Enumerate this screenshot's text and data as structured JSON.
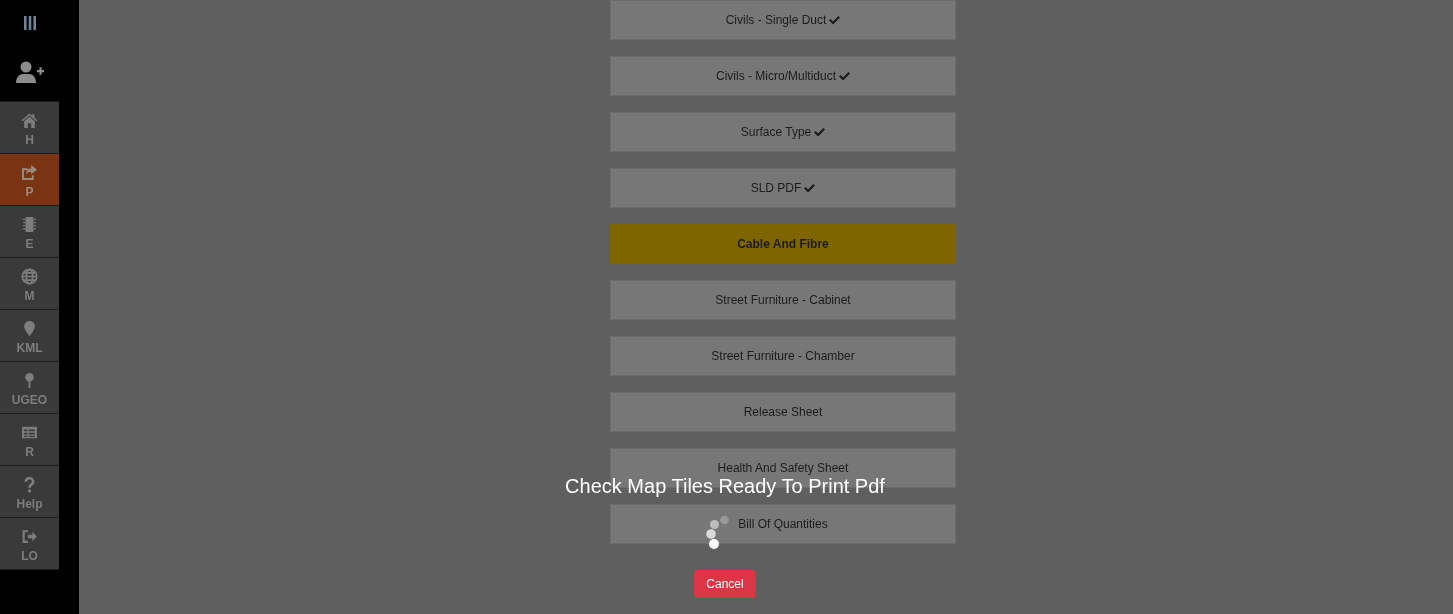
{
  "sidebar": {
    "nav": [
      {
        "label": "H",
        "selected": false
      },
      {
        "label": "P",
        "selected": true
      },
      {
        "label": "E",
        "selected": false
      },
      {
        "label": "M",
        "selected": false
      },
      {
        "label": "KML",
        "selected": false
      },
      {
        "label": "UGEO",
        "selected": false
      },
      {
        "label": "R",
        "selected": false
      },
      {
        "label": "Help",
        "selected": false
      },
      {
        "label": "LO",
        "selected": false
      }
    ]
  },
  "items": [
    {
      "label": "Civils - Single Duct",
      "done": true,
      "selected": false
    },
    {
      "label": "Civils - Micro/Multiduct",
      "done": true,
      "selected": false
    },
    {
      "label": "Surface Type",
      "done": true,
      "selected": false
    },
    {
      "label": "SLD PDF",
      "done": true,
      "selected": false
    },
    {
      "label": "Cable And Fibre",
      "done": false,
      "selected": true
    },
    {
      "label": "Street Furniture - Cabinet",
      "done": false,
      "selected": false
    },
    {
      "label": "Street Furniture - Chamber",
      "done": false,
      "selected": false
    },
    {
      "label": "Release Sheet",
      "done": false,
      "selected": false
    },
    {
      "label": "Health And Safety Sheet",
      "done": false,
      "selected": false
    },
    {
      "label": "Bill Of Quantities",
      "done": false,
      "selected": false
    }
  ],
  "overlay": {
    "message": "Check Map Tiles Ready To Print Pdf",
    "cancel": "Cancel"
  }
}
